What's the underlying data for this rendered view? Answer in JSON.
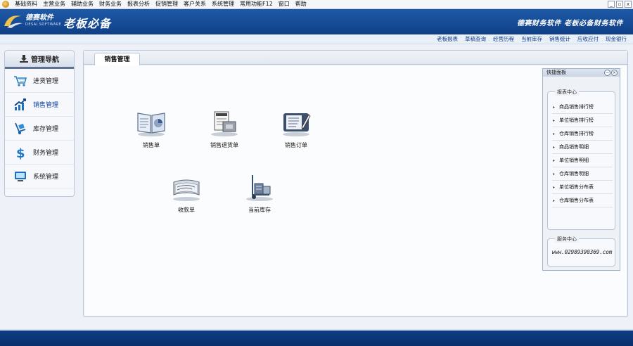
{
  "menu": [
    "基础资料",
    "主营业务",
    "辅助业务",
    "财务业务",
    "报表分析",
    "促销管理",
    "客户关系",
    "系统管理",
    "常用功能F12",
    "窗口",
    "帮助"
  ],
  "window_controls": [
    "_",
    "▫",
    "x"
  ],
  "header": {
    "brand": "德赛软件",
    "brand_sub": "DESAI SOFTWARE",
    "slogan": "老板必备",
    "slogan_right": "德赛财务软件 老板必备财务软件"
  },
  "quick_links": [
    "老板报表",
    "草稿查询",
    "经营历程",
    "当前库存",
    "销售统计",
    "应收应付",
    "现金银行"
  ],
  "nav": {
    "title": "管理导航",
    "items": [
      {
        "label": "进货管理",
        "icon": "cart-icon"
      },
      {
        "label": "销售管理",
        "icon": "chart-up-icon"
      },
      {
        "label": "库存管理",
        "icon": "dolly-icon"
      },
      {
        "label": "财务管理",
        "icon": "dollar-icon"
      },
      {
        "label": "系统管理",
        "icon": "monitor-icon"
      }
    ]
  },
  "main": {
    "tab": "销售管理",
    "functions": [
      {
        "label": "销售单",
        "icon": "book-chart-icon"
      },
      {
        "label": "销售退货单",
        "icon": "order-return-icon"
      },
      {
        "label": "销售订单",
        "icon": "order-form-icon"
      },
      {
        "label": "收款单",
        "icon": "cheque-icon"
      },
      {
        "label": "当前库存",
        "icon": "hand-truck-icon"
      }
    ]
  },
  "quick_panel": {
    "title": "快捷面板",
    "report_group": "报表中心",
    "reports": [
      "商品销售排行榜",
      "单位销售排行榜",
      "仓库销售排行榜",
      "商品销售明细",
      "单位销售明细",
      "仓库销售明细",
      "单位销售分布表",
      "仓库销售分布表"
    ],
    "service_group": "服务中心",
    "website": "www.02989390369.com"
  }
}
